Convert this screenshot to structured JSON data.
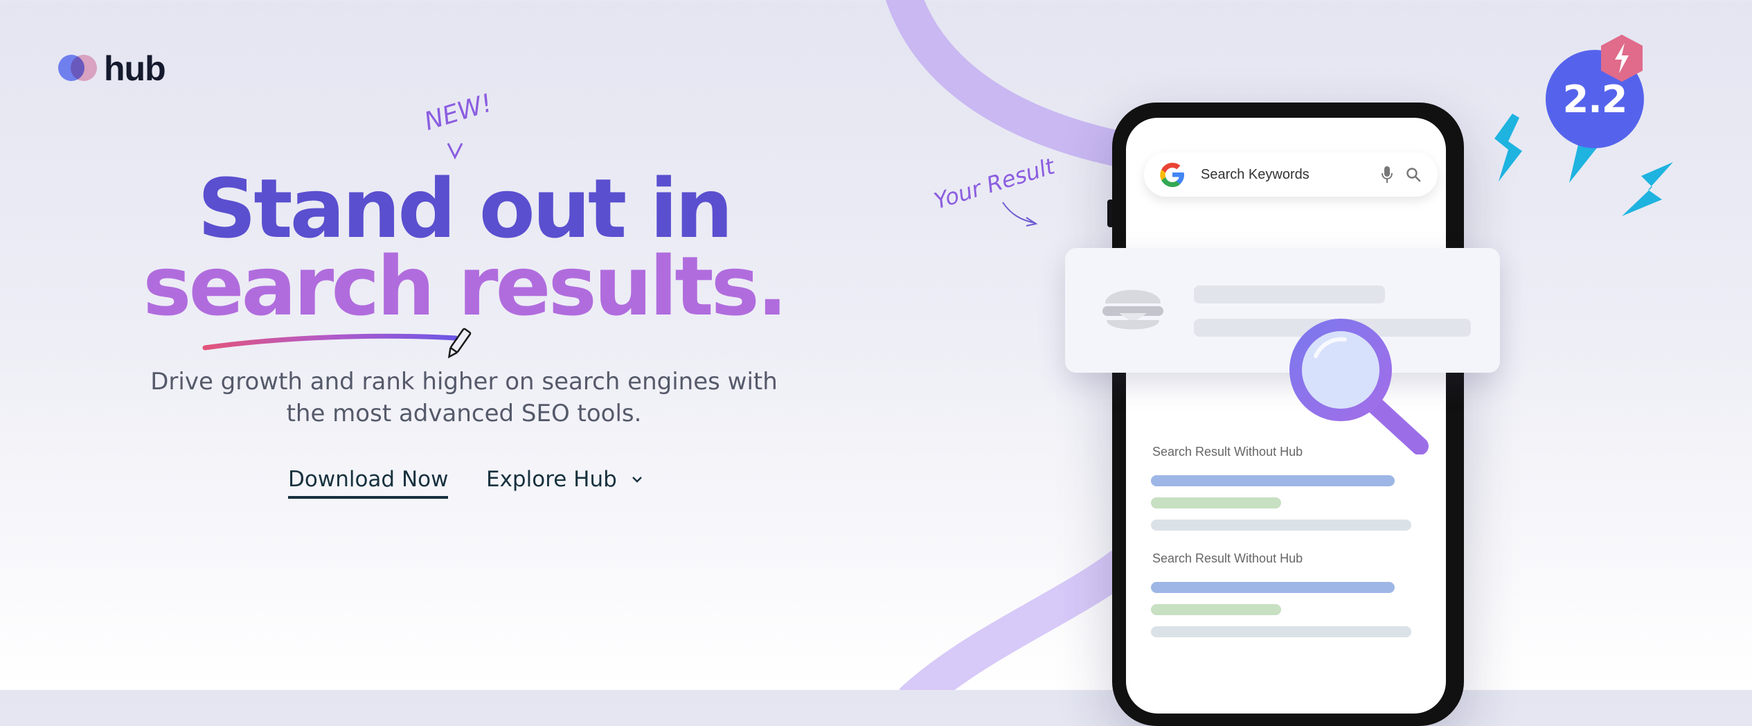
{
  "brand": {
    "name": "hub"
  },
  "hero": {
    "badge": "NEW!",
    "headline_line1": "Stand out in",
    "headline_line2": "search results.",
    "subtitle_line1": "Drive growth and rank higher on search engines with",
    "subtitle_line2": "the most advanced SEO tools."
  },
  "cta": {
    "download_label": "Download Now",
    "explore_label": "Explore Hub"
  },
  "illustration": {
    "annotation": "Your Result",
    "search_placeholder": "Search Keywords",
    "result_label_1": "Search Result Without Hub",
    "result_label_2": "Search Result Without Hub",
    "score": "2.2"
  },
  "colors": {
    "accent_purple": "#5a4fcf",
    "accent_pink": "#b06cdd",
    "text_dark": "#17313e",
    "score_blue": "#5563ec",
    "badge_pink": "#e06b8b",
    "bolt_cyan": "#1fb3e0"
  },
  "icons": [
    "logo-dots-icon",
    "pencil-icon",
    "chevron-down-icon",
    "google-g-icon",
    "microphone-icon",
    "search-icon",
    "burger-icon",
    "magnifier-icon",
    "lightning-icon"
  ]
}
